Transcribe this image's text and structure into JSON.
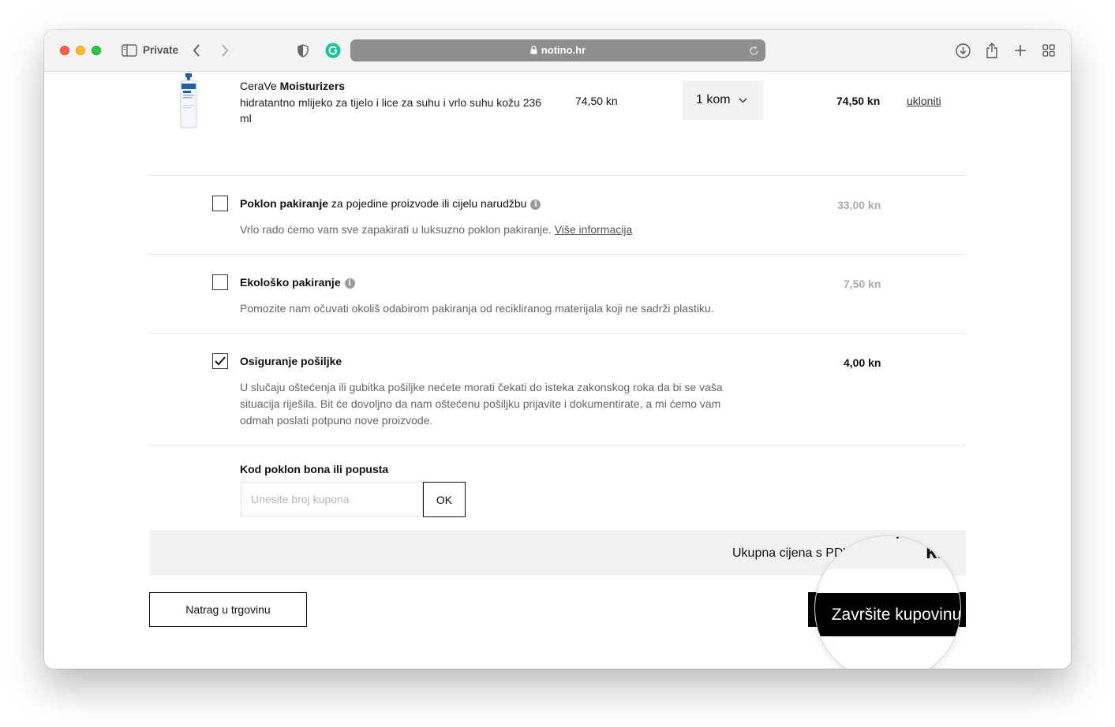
{
  "browser": {
    "private_label": "Private",
    "url": "notino.hr"
  },
  "product": {
    "brand": "CeraVe",
    "name": "Moisturizers",
    "description": "hidratantno mlijeko za tijelo i lice za suhu i vrlo suhu kožu 236 ml",
    "unit_price": "74,50 kn",
    "quantity": "1 kom",
    "total_price": "74,50 kn",
    "remove_label": "ukloniti"
  },
  "options": {
    "gift": {
      "title_bold": "Poklon pakiranje",
      "title_rest": " za pojedine proizvode ili cijelu narudžbu",
      "description": "Vrlo rado ćemo vam sve zapakirati u luksuzno poklon pakiranje. ",
      "link": "Više informacija",
      "price": "33,00 kn",
      "checked": false
    },
    "eco": {
      "title_bold": "Ekološko pakiranje",
      "description": "Pomozite nam očuvati okoliš odabirom pakiranja od recikliranog materijala koji ne sadrži plastiku.",
      "price": "7,50 kn",
      "checked": false
    },
    "insurance": {
      "title_bold": "Osiguranje pošiljke",
      "description": "U slučaju oštećenja ili gubitka pošiljke nećete morati čekati do isteka zakonskog roka da bi se vaša situacija riješila. Bit će dovoljno da nam oštećenu pošiljku prijavite i dokumentirate, a mi ćemo vam odmah poslati potpuno nove proizvode.",
      "price": "4,00 kn",
      "checked": true
    }
  },
  "coupon": {
    "label": "Kod poklon bona ili popusta",
    "placeholder": "Unesite broj kupona",
    "value": "",
    "submit_label": "OK"
  },
  "total": {
    "label": "Ukupna cijena s PDV",
    "currency_fragment": "kn"
  },
  "actions": {
    "back_label": "Natrag u trgovinu",
    "finish_label": "Završite kupovinu"
  },
  "colors": {
    "accent_button": "#000000",
    "grammarly": "#15c39a",
    "address_bar": "#8e8e8e"
  },
  "icons": [
    "sidebar-icon",
    "chevron-left-icon",
    "chevron-right-icon",
    "shield-icon",
    "grammarly-icon",
    "lock-icon",
    "reload-icon",
    "download-icon",
    "share-icon",
    "plus-icon",
    "tab-grid-icon",
    "chevron-down-icon",
    "info-icon",
    "checkmark-icon"
  ]
}
